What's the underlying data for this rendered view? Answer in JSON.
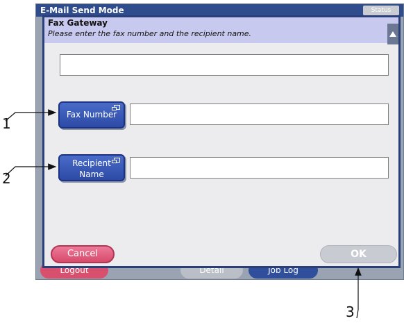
{
  "background": {
    "title": "E-Mail Send Mode",
    "status_tab": "Status",
    "buttons": {
      "logout": "Logout",
      "detail": "Detail",
      "job_log": "Job Log"
    }
  },
  "dialog": {
    "title": "Fax Gateway",
    "subtitle": "Please enter the fax number and the recipient name.",
    "top_field_value": "",
    "fax_number_button": "Fax Number",
    "fax_number_value": "",
    "recipient_button_line1": "Recipient",
    "recipient_button_line2": "Name",
    "recipient_value": "",
    "cancel": "Cancel",
    "ok": "OK"
  },
  "callouts": [
    "1",
    "2",
    "3"
  ],
  "colors": {
    "title_bar": "#2f4c8c",
    "dialog_header": "#c8c9ee",
    "primary_button": "#2c4aa6",
    "cancel_button": "#d84a6c",
    "ok_disabled": "#c8cbd1"
  }
}
